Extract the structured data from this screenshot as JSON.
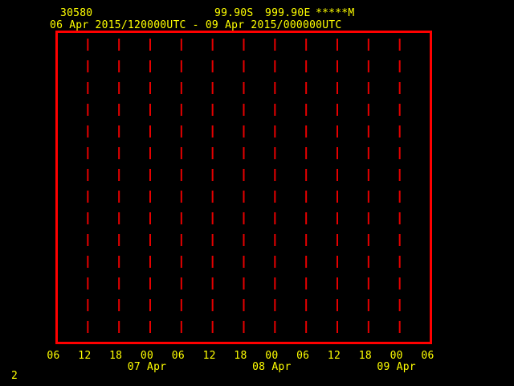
{
  "header": {
    "station_id": "30580",
    "latitude": "99.90S",
    "longitude": "999.90E",
    "elevation": "*****M",
    "time_range": "06 Apr 2015/120000UTC - 09 Apr 2015/000000UTC"
  },
  "footer": {
    "page_number": "2"
  },
  "colors": {
    "background": "#000000",
    "frame": "#ff0000",
    "grid": "#e60000",
    "text": "#ffff00"
  },
  "chart_data": {
    "type": "line",
    "title": "30580",
    "subtitle": "06 Apr 2015/120000UTC - 09 Apr 2015/000000UTC",
    "xlabel": "",
    "ylabel": "",
    "series": [],
    "x_tick_interval_hours": 6,
    "x_tick_labels": [
      "06",
      "12",
      "18",
      "00",
      "06",
      "12",
      "18",
      "00",
      "06",
      "12",
      "18",
      "00",
      "06"
    ],
    "date_labels": [
      {
        "label": "07 Apr",
        "tick_index": 3
      },
      {
        "label": "08 Apr",
        "tick_index": 7
      },
      {
        "label": "09 Apr",
        "tick_index": 11
      }
    ],
    "grid": {
      "vertical_dashed": true,
      "interior_line_count": 11,
      "frame": "solid-red-rectangle"
    },
    "legend": "none"
  }
}
